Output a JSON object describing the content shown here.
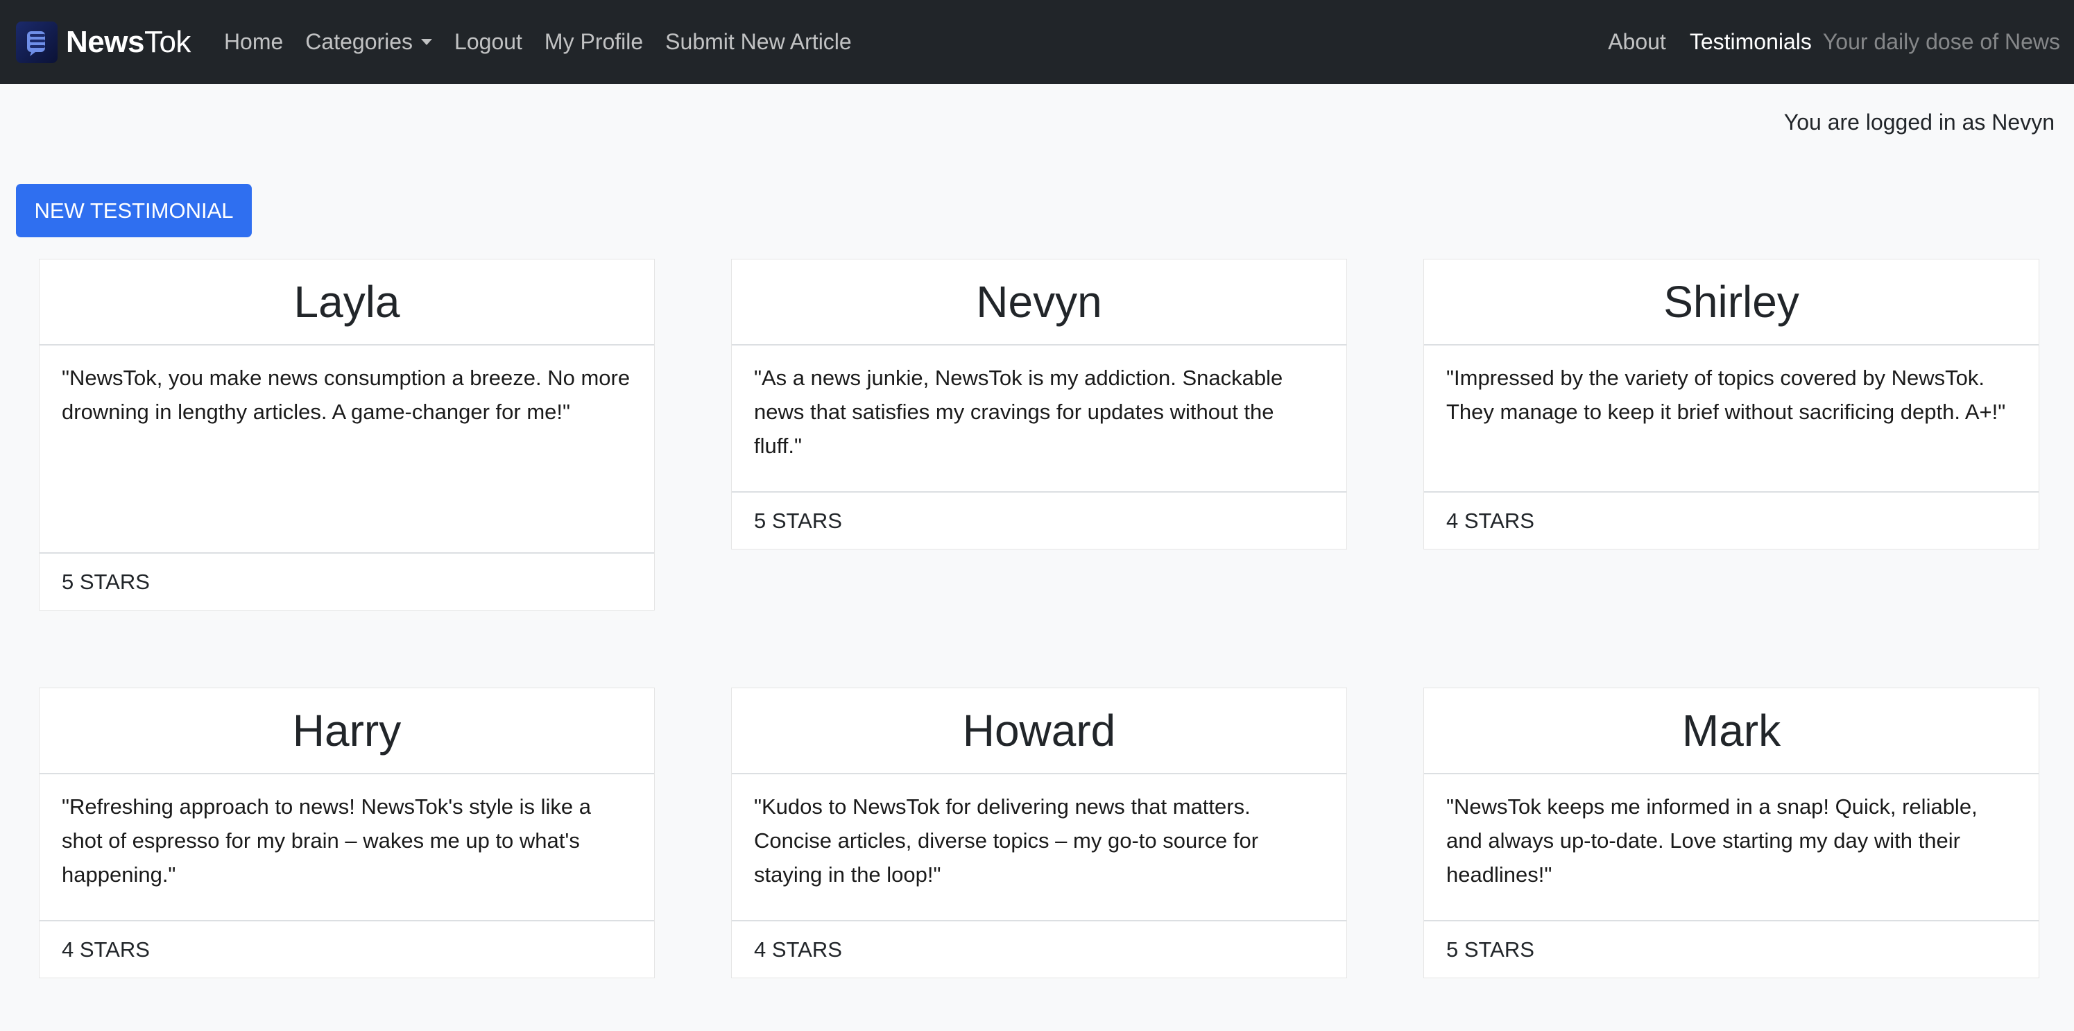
{
  "navbar": {
    "brand_bold": "News",
    "brand_light": "Tok",
    "links": {
      "home": "Home",
      "categories": "Categories",
      "logout": "Logout",
      "my_profile": "My Profile",
      "submit": "Submit New Article"
    },
    "right": {
      "about": "About",
      "testimonials": "Testimonials",
      "tagline": "Your daily dose of News"
    }
  },
  "status": {
    "logged_in": "You are logged in as Nevyn"
  },
  "actions": {
    "new_testimonial": "NEW TESTIMONIAL"
  },
  "testimonials": [
    {
      "name": "Layla",
      "text": "\"NewsTok, you make news consumption a breeze. No more drowning in lengthy articles. A game-changer for me!\"",
      "rating": "5 STARS"
    },
    {
      "name": "Nevyn",
      "text": "\"As a news junkie, NewsTok is my addiction. Snackable news that satisfies my cravings for updates without the fluff.\"",
      "rating": "5 STARS"
    },
    {
      "name": "Shirley",
      "text": "\"Impressed by the variety of topics covered by NewsTok. They manage to keep it brief without sacrificing depth. A+!\"",
      "rating": "4 STARS"
    },
    {
      "name": "Harry",
      "text": "\"Refreshing approach to news! NewsTok's style is like a shot of espresso for my brain – wakes me up to what's happening.\"",
      "rating": "4 STARS"
    },
    {
      "name": "Howard",
      "text": "\"Kudos to NewsTok for delivering news that matters. Concise articles, diverse topics – my go-to source for staying in the loop!\"",
      "rating": "4 STARS"
    },
    {
      "name": "Mark",
      "text": "\"NewsTok keeps me informed in a snap! Quick, reliable, and always up-to-date. Love starting my day with their headlines!\"",
      "rating": "5 STARS"
    }
  ]
}
